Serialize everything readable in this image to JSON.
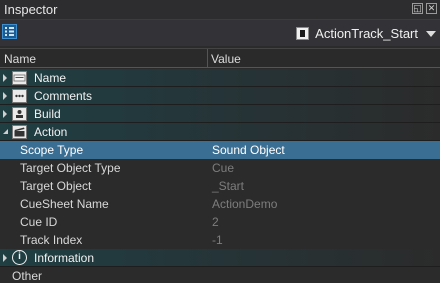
{
  "window": {
    "title": "Inspector"
  },
  "toolbar": {
    "selected_object": "ActionTrack_Start"
  },
  "columns": {
    "name": "Name",
    "value": "Value"
  },
  "categories": {
    "name": {
      "label": "Name",
      "icon": "name-card-icon",
      "state": "collapsed"
    },
    "comments": {
      "label": "Comments",
      "icon": "comments-icon",
      "state": "collapsed"
    },
    "build": {
      "label": "Build",
      "icon": "build-icon",
      "state": "collapsed"
    },
    "action": {
      "label": "Action",
      "icon": "clapperboard-icon",
      "state": "expanded"
    },
    "information": {
      "label": "Information",
      "icon": "info-icon",
      "state": "collapsed"
    }
  },
  "action_properties": [
    {
      "label": "Scope Type",
      "value": "Sound Object",
      "selected": true,
      "readonly": false
    },
    {
      "label": "Target Object Type",
      "value": "Cue",
      "selected": false,
      "readonly": true
    },
    {
      "label": "Target Object",
      "value": "_Start",
      "selected": false,
      "readonly": true
    },
    {
      "label": "CueSheet Name",
      "value": "ActionDemo",
      "selected": false,
      "readonly": true
    },
    {
      "label": "Cue ID",
      "value": "2",
      "selected": false,
      "readonly": true
    },
    {
      "label": "Track Index",
      "value": "-1",
      "selected": false,
      "readonly": true
    }
  ],
  "footer": {
    "other_label": "Other"
  },
  "colors": {
    "selection": "#3b6e93",
    "category_tint": "#1f3f43",
    "readonly_text": "#7d7d7d"
  },
  "info_glyph": "i"
}
